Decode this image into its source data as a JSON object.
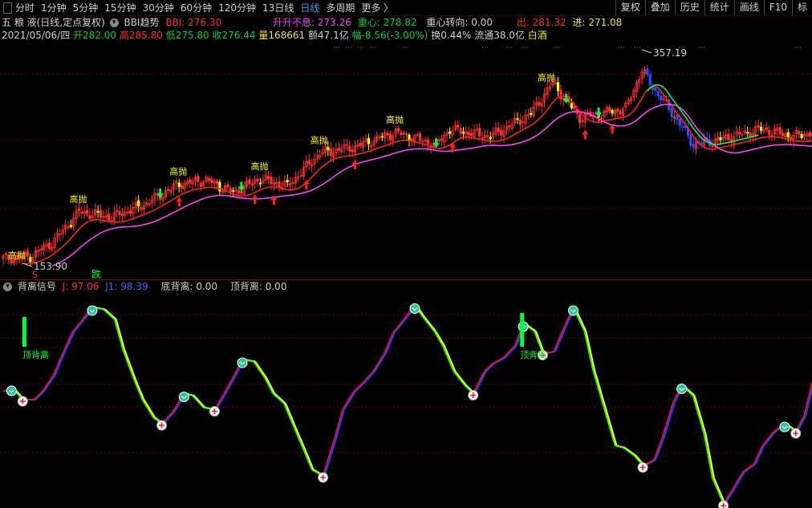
{
  "period_tabs": [
    "分时",
    "1分钟",
    "5分钟",
    "15分钟",
    "30分钟",
    "60分钟",
    "120分钟",
    "13日线",
    "日线",
    "多周期",
    "更多 〉"
  ],
  "active_tab": "日线",
  "right_buttons": [
    "复权",
    "叠加",
    "历史",
    "统计",
    "画线",
    "F10",
    "标"
  ],
  "header": {
    "stock": "五 粮 液(日线,定点复权)",
    "indicator_name": "BBI趋势",
    "bbi": "BBI: 276.30",
    "shengsheng": "升升不息: 273.26",
    "zhongxin": "重心: 278.82",
    "zhongxin_turn": "重心转向: 0.00",
    "chu": "出: 281.32",
    "jin": "进: 271.08"
  },
  "quote": {
    "date": "2021/05/06/四",
    "open": "开282.00",
    "high": "高285.80",
    "low": "低275.80",
    "close": "收276.44",
    "volume": "量168661",
    "amount": "额47.1亿",
    "change": "幅-8.56(-3.00%)",
    "turnover": "换0.44%",
    "float": "流通38.0亿",
    "sector": "白酒"
  },
  "price_labels": {
    "max": "357.19",
    "min": "153.90",
    "gaopao": "高抛",
    "die": "跌",
    "s": "S"
  },
  "lower_header": {
    "title": "背离信号",
    "j": "J: 97.06",
    "j1": "J1: 98.39",
    "bottom_div": "底背离: 0.00",
    "top_div": "顶背离: 0.00"
  },
  "div_label": "顶背离",
  "colors": {
    "up": "#ff3030",
    "down": "#00d0ff",
    "ma_red": "#ff2020",
    "ma_mag": "#ff40ff",
    "green": "#00ff40",
    "yellow": "#ffff00",
    "blue": "#1f3cff",
    "grid": "#7a0000"
  },
  "chart_data": {
    "type": "candlestick+indicator",
    "price_max": 357.19,
    "price_min": 153.9,
    "gaopao_at": [
      28,
      65,
      95,
      117,
      145,
      201
    ],
    "oscillator": {
      "series": [
        {
          "name": "J"
        },
        {
          "name": "J1"
        }
      ],
      "y_range": [
        0,
        100
      ],
      "points": [
        [
          0,
          56
        ],
        [
          3,
          58
        ],
        [
          7,
          52
        ],
        [
          11,
          52
        ],
        [
          14,
          56
        ],
        [
          18,
          64
        ],
        [
          22,
          77
        ],
        [
          25,
          86
        ],
        [
          28,
          91
        ],
        [
          32,
          98
        ],
        [
          36,
          97
        ],
        [
          40,
          92
        ],
        [
          43,
          77
        ],
        [
          47,
          62
        ],
        [
          50,
          52
        ],
        [
          54,
          43
        ],
        [
          57,
          40
        ],
        [
          61,
          46
        ],
        [
          65,
          55
        ],
        [
          68,
          54
        ],
        [
          72,
          48
        ],
        [
          76,
          47
        ],
        [
          79,
          54
        ],
        [
          83,
          64
        ],
        [
          86,
          72
        ],
        [
          90,
          71
        ],
        [
          94,
          63
        ],
        [
          97,
          55
        ],
        [
          101,
          50
        ],
        [
          104,
          40
        ],
        [
          108,
          27
        ],
        [
          111,
          17
        ],
        [
          115,
          14
        ],
        [
          119,
          32
        ],
        [
          122,
          47
        ],
        [
          126,
          56
        ],
        [
          129,
          60
        ],
        [
          133,
          66
        ],
        [
          137,
          75
        ],
        [
          140,
          85
        ],
        [
          144,
          92
        ],
        [
          148,
          99
        ],
        [
          151,
          93
        ],
        [
          155,
          86
        ],
        [
          158,
          79
        ],
        [
          162,
          66
        ],
        [
          166,
          59
        ],
        [
          169,
          55
        ],
        [
          173,
          66
        ],
        [
          176,
          70
        ],
        [
          180,
          73
        ],
        [
          184,
          79
        ],
        [
          187,
          90
        ],
        [
          191,
          86
        ],
        [
          194,
          75
        ],
        [
          198,
          76
        ],
        [
          202,
          89
        ],
        [
          205,
          98
        ],
        [
          209,
          86
        ],
        [
          212,
          67
        ],
        [
          216,
          48
        ],
        [
          220,
          29
        ],
        [
          223,
          28
        ],
        [
          227,
          24
        ],
        [
          230,
          19
        ],
        [
          234,
          22
        ],
        [
          237,
          33
        ],
        [
          241,
          51
        ],
        [
          244,
          59
        ],
        [
          248,
          54
        ],
        [
          252,
          35
        ],
        [
          255,
          13
        ],
        [
          259,
          0
        ],
        [
          263,
          9
        ],
        [
          266,
          16
        ],
        [
          270,
          20
        ],
        [
          273,
          29
        ],
        [
          277,
          36
        ],
        [
          281,
          40
        ],
        [
          285,
          36
        ],
        [
          288,
          44
        ],
        [
          292,
          67
        ]
      ]
    }
  }
}
